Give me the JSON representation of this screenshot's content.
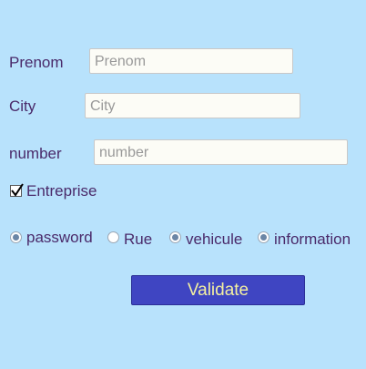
{
  "form": {
    "prenom": {
      "label": "Prenom",
      "placeholder": "Prenom"
    },
    "city": {
      "label": "City",
      "placeholder": "City"
    },
    "number": {
      "label": "number",
      "placeholder": "number"
    },
    "entreprise": {
      "label": "Entreprise",
      "checked": true
    },
    "radios": [
      {
        "label": "password",
        "checked": true
      },
      {
        "label": "Rue",
        "checked": false
      },
      {
        "label": "vehicule",
        "checked": true
      },
      {
        "label": "information",
        "checked": true
      }
    ],
    "submit_label": "Validate"
  },
  "colors": {
    "background": "#b8e2fc",
    "label_text": "#4a2a6a",
    "button_bg": "#3f45c2",
    "button_text": "#f4f0a0"
  }
}
